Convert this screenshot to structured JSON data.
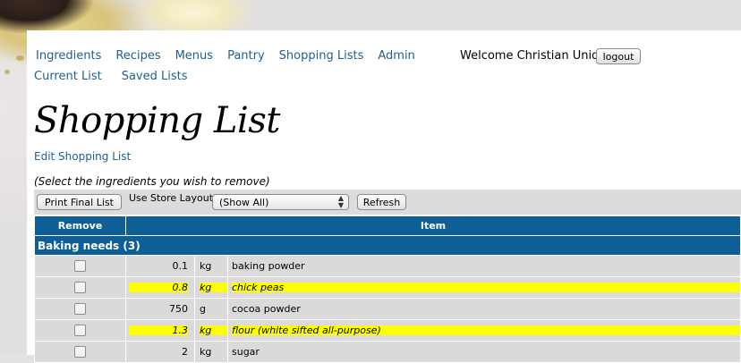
{
  "nav": {
    "main": [
      "Ingredients",
      "Recipes",
      "Menus",
      "Pantry",
      "Shopping Lists",
      "Admin"
    ],
    "sub": [
      "Current List",
      "Saved Lists"
    ]
  },
  "user": {
    "welcome": "Welcome Christian Union",
    "logout_label": "logout"
  },
  "page": {
    "title": "Shopping List",
    "edit_link": "Edit Shopping List",
    "instructions": "(Select the ingredients you wish to remove)"
  },
  "toolbar": {
    "print_label": "Print Final List",
    "layout_label": "Use Store Layout:",
    "layout_selected": "(Show All)",
    "refresh_label": "Refresh"
  },
  "table": {
    "headers": {
      "remove": "Remove",
      "item": "Item"
    },
    "group": "Baking needs (3)",
    "rows": [
      {
        "qty": "0.1",
        "unit": "kg",
        "name": "baking powder",
        "highlight": false
      },
      {
        "qty": "0.8",
        "unit": "kg",
        "name": "chick peas",
        "highlight": true
      },
      {
        "qty": "750",
        "unit": "g",
        "name": "cocoa powder",
        "highlight": false
      },
      {
        "qty": "1.3",
        "unit": "kg",
        "name": "flour (white sifted all-purpose)",
        "highlight": true
      },
      {
        "qty": "2",
        "unit": "kg",
        "name": "sugar",
        "highlight": false
      }
    ]
  },
  "colors": {
    "link": "#22608f",
    "header_bg": "#0d5f96",
    "row_bg": "#dadada",
    "highlight": "#ffff00"
  }
}
